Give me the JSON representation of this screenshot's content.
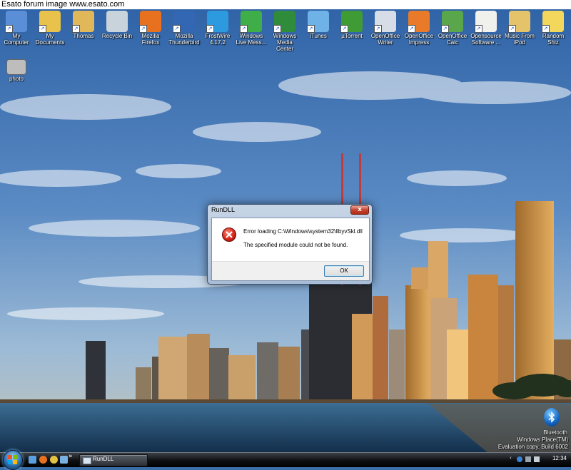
{
  "watermark": "Esato forum image www.esato.com",
  "desktop_icons": [
    {
      "label": "My Computer",
      "icon": "my-computer-icon",
      "color": "#5a8fd8"
    },
    {
      "label": "My Documents",
      "icon": "my-documents-icon",
      "color": "#e8c24a"
    },
    {
      "label": "Thomas",
      "icon": "user-folder-icon",
      "color": "#e0b85a"
    },
    {
      "label": "Recycle Bin",
      "icon": "recycle-bin-icon",
      "color": "#c9d3dc"
    },
    {
      "label": "Mozilla Firefox",
      "icon": "firefox-icon",
      "color": "#e8711f"
    },
    {
      "label": "Mozilla Thunderbird",
      "icon": "thunderbird-icon",
      "color": "#3467b3"
    },
    {
      "label": "FrostWire 4.17.2",
      "icon": "frostwire-icon",
      "color": "#2d9ae0"
    },
    {
      "label": "Windows Live Mess...",
      "icon": "messenger-icon",
      "color": "#3fae49"
    },
    {
      "label": "Windows Media Center",
      "icon": "media-center-icon",
      "color": "#2f8c3a"
    },
    {
      "label": "iTunes",
      "icon": "itunes-icon",
      "color": "#6fb2e8"
    },
    {
      "label": "µTorrent",
      "icon": "utorrent-icon",
      "color": "#3f9b34"
    },
    {
      "label": "OpenOffice Writer",
      "icon": "oo-writer-icon",
      "color": "#d7dde6"
    },
    {
      "label": "OpenOffice Impress",
      "icon": "oo-impress-icon",
      "color": "#e97a2a"
    },
    {
      "label": "OpenOffice Calc",
      "icon": "oo-calc-icon",
      "color": "#5aa64a"
    },
    {
      "label": "Opensource Software ...",
      "icon": "document-icon",
      "color": "#f0f0ec"
    },
    {
      "label": "Music From iPod",
      "icon": "music-folder-icon",
      "color": "#e4c36a"
    },
    {
      "label": "Random Shiz",
      "icon": "random-folder-icon",
      "color": "#f3d65c"
    }
  ],
  "photo_icon": {
    "label": "photo",
    "icon": "photo-icon"
  },
  "dialog": {
    "title": "RunDLL",
    "close_label": "x",
    "message_line1": "Error loading C:\\Windows\\system32\\llbyvSkl.dll",
    "message_line2": "The specified module could not be found.",
    "ok_label": "OK"
  },
  "taskbar": {
    "quicklaunch_chevron": "»",
    "task_label": "RunDLL",
    "clock": "12:34"
  },
  "watermark_info": {
    "bluetooth": "Bluetooth",
    "line1": "Windows Place(TM)",
    "line2": "Evaluation copy. Build 6002"
  }
}
